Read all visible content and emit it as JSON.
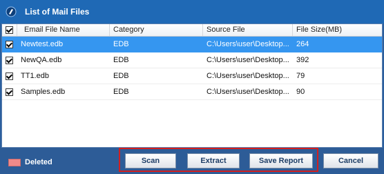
{
  "window": {
    "title": "List of Mail Files"
  },
  "table": {
    "headers": [
      "Email File Name",
      "Category",
      "Source File",
      "File Size(MB)"
    ],
    "rows": [
      {
        "name": "Newtest.edb",
        "category": "EDB",
        "source": "C:\\Users\\user\\Desktop...",
        "size": "264",
        "checked": true,
        "selected": true
      },
      {
        "name": "NewQA.edb",
        "category": "EDB",
        "source": "C:\\Users\\user\\Desktop...",
        "size": "392",
        "checked": true,
        "selected": false
      },
      {
        "name": "TT1.edb",
        "category": "EDB",
        "source": "C:\\Users\\user\\Desktop...",
        "size": "79",
        "checked": true,
        "selected": false
      },
      {
        "name": "Samples.edb",
        "category": "EDB",
        "source": "C:\\Users\\user\\Desktop...",
        "size": "90",
        "checked": true,
        "selected": false
      }
    ]
  },
  "footer": {
    "legend_label": "Deleted",
    "legend_color": "#f08a8a",
    "scan_label": "Scan",
    "extract_label": "Extract",
    "save_report_label": "Save Report",
    "cancel_label": "Cancel"
  },
  "colors": {
    "selected_row": "#3596f0",
    "highlight_box": "#d21f1f",
    "titlebar": "#1f69b5"
  }
}
